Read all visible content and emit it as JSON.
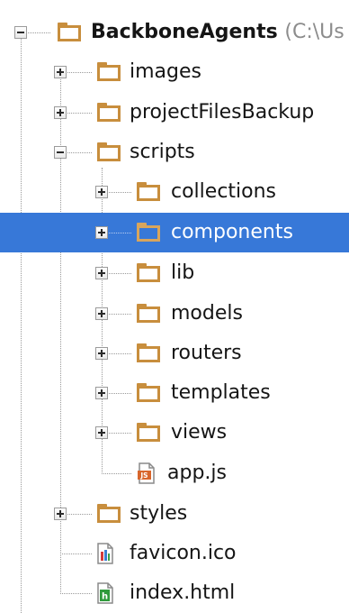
{
  "tree": {
    "root": {
      "name": "BackboneAgents",
      "path_hint": "(C:\\Us",
      "icon": "folder-icon",
      "expanded": true
    },
    "root_children": [
      {
        "name": "images",
        "icon": "folder-icon",
        "expander": "plus"
      },
      {
        "name": "projectFilesBackup",
        "icon": "folder-icon",
        "expander": "plus"
      },
      {
        "name": "scripts",
        "icon": "folder-icon",
        "expander": "minus"
      },
      {
        "name": "styles",
        "icon": "folder-icon",
        "expander": "plus"
      },
      {
        "name": "favicon.ico",
        "icon": "image-file-icon"
      },
      {
        "name": "index.html",
        "icon": "html-file-icon"
      }
    ],
    "scripts_children": [
      {
        "name": "collections",
        "icon": "folder-icon",
        "expander": "plus"
      },
      {
        "name": "components",
        "icon": "folder-icon",
        "expander": "plus",
        "selected": true
      },
      {
        "name": "lib",
        "icon": "folder-icon",
        "expander": "plus"
      },
      {
        "name": "models",
        "icon": "folder-icon",
        "expander": "plus"
      },
      {
        "name": "routers",
        "icon": "folder-icon",
        "expander": "plus"
      },
      {
        "name": "templates",
        "icon": "folder-icon",
        "expander": "plus"
      },
      {
        "name": "views",
        "icon": "folder-icon",
        "expander": "plus"
      },
      {
        "name": "app.js",
        "icon": "js-file-icon",
        "badge": "JS"
      }
    ]
  },
  "colors": {
    "selection": "#3778d8",
    "folder": "#c88e3d",
    "text": "#151515",
    "muted": "#8c8c8c"
  }
}
